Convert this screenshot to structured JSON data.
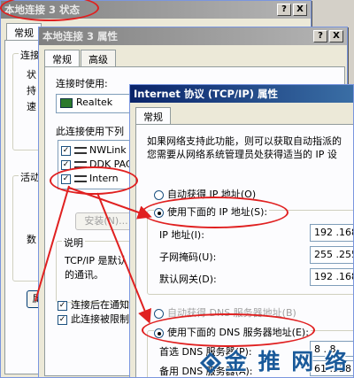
{
  "status_window": {
    "title": "本地连接 3 状态",
    "tab_general": "常规",
    "group_connection": "连接",
    "rows": [
      "状",
      "持",
      "速"
    ],
    "group_activity": "活动",
    "count_label": "数",
    "props_button": "属",
    "help_btn": "?",
    "close_btn": "X"
  },
  "props_window": {
    "title": "本地连接 3 属性",
    "tabs": [
      "常规",
      "高级"
    ],
    "connect_using_label": "连接时使用:",
    "adapter_name": "Realtek",
    "items_label": "此连接使用下列",
    "components": [
      {
        "checked": true,
        "name": "NWLink"
      },
      {
        "checked": true,
        "name": "DDK PAC"
      },
      {
        "checked": true,
        "name": "Intern"
      }
    ],
    "install_button": "安装(N)...",
    "description_title": "说明",
    "description_text": [
      "TCP/IP 是默认",
      "的通讯。"
    ],
    "opt_show_icon": "连接后在通知",
    "opt_limited": "此连接被限制",
    "help_btn": "?",
    "close_btn": "X"
  },
  "tcpip_window": {
    "title": "Internet 协议 (TCP/IP) 属性",
    "tab_general": "常规",
    "intro_line1": "如果网络支持此功能，则可以获取自动指派的",
    "intro_line2": "您需要从网络系统管理员处获得适当的 IP 设",
    "radio_auto_ip": "自动获得 IP 地址(O)",
    "radio_manual_ip": "使用下面的 IP 地址(S):",
    "ip_label": "IP 地址(I):",
    "ip_value": "192 .168",
    "mask_label": "子网掩码(U):",
    "mask_value": "255 .255",
    "gateway_label": "默认网关(D):",
    "gateway_value": "192 .168",
    "radio_auto_dns": "自动获得 DNS 服务器地址(B)",
    "radio_manual_dns": "使用下面的 DNS 服务器地址(E):",
    "preferred_dns_label": "首选 DNS 服务器(P):",
    "preferred_dns_value": "8 . 8",
    "alt_dns_label": "备用 DNS 服务器(A):",
    "alt_dns_value": "61 .128",
    "help_btn": "?",
    "close_btn": "X"
  },
  "watermark": {
    "text": "金 推 网 络"
  },
  "colors": {
    "annotation_red": "#e02020",
    "title_active": "#0a246a",
    "watermark_blue": "#1a5a9a"
  }
}
